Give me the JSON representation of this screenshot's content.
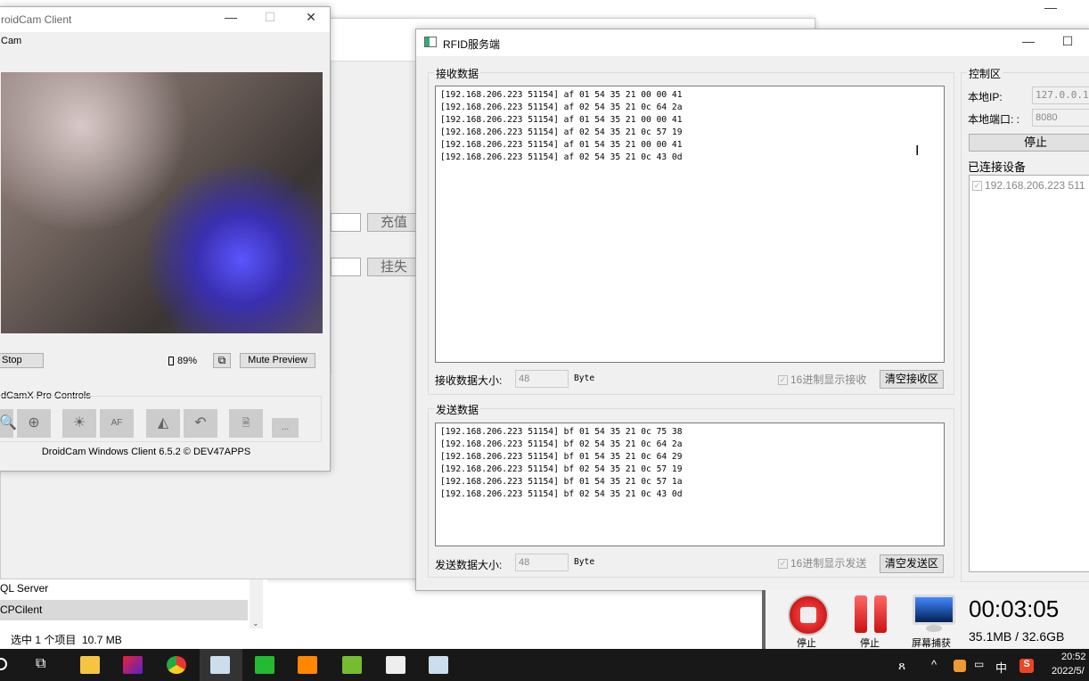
{
  "background_window": {
    "recharge_label": "充值",
    "report_loss_label": "挂失"
  },
  "explorer": {
    "items": [
      "QL Server",
      "CPCilent"
    ],
    "status": "选中 1 个项目  10.7 MB"
  },
  "droidcam": {
    "title": "roidCam Client",
    "menu": "Cam",
    "stop_label": "Stop",
    "battery": "89%",
    "mute_label": "Mute Preview",
    "pro_controls_label": "dCamX Pro Controls",
    "af_label": "AF",
    "more_label": "...",
    "footer": "DroidCam Windows Client 6.5.2 © DEV47APPS"
  },
  "rfid": {
    "title": "RFID服务端",
    "receive": {
      "group_label": "接收数据",
      "lines": [
        "[192.168.206.223 51154] af 01 54 35 21 00 00 41",
        "[192.168.206.223 51154] af 02 54 35 21 0c 64 2a",
        "[192.168.206.223 51154] af 01 54 35 21 00 00 41",
        "[192.168.206.223 51154] af 02 54 35 21 0c 57 19",
        "[192.168.206.223 51154] af 01 54 35 21 00 00 41",
        "[192.168.206.223 51154] af 02 54 35 21 0c 43 0d"
      ],
      "size_label": "接收数据大小:",
      "size_value": "48",
      "unit": "Byte",
      "hex_label": "16进制显示接收",
      "hex_checked": true,
      "clear_label": "清空接收区"
    },
    "send": {
      "group_label": "发送数据",
      "lines": [
        "[192.168.206.223 51154] bf 01 54 35 21 0c 75 38",
        "[192.168.206.223 51154] bf 02 54 35 21 0c 64 2a",
        "[192.168.206.223 51154] bf 01 54 35 21 0c 64 29",
        "[192.168.206.223 51154] bf 02 54 35 21 0c 57 19",
        "[192.168.206.223 51154] bf 01 54 35 21 0c 57 1a",
        "[192.168.206.223 51154] bf 02 54 35 21 0c 43 0d"
      ],
      "size_label": "发送数据大小:",
      "size_value": "48",
      "unit": "Byte",
      "hex_label": "16进制显示发送",
      "hex_checked": true,
      "clear_label": "清空发送区"
    },
    "control": {
      "group_label": "控制区",
      "ip_label": "本地IP:",
      "ip_value": "127.0.0.1",
      "port_label": "本地端口: :",
      "port_value": "8080",
      "stop_label": "停止",
      "devices_label": "已连接设备",
      "devices": [
        "192.168.206.223 511"
      ]
    }
  },
  "recorder": {
    "stop_label": "停止",
    "pause_label": "停止",
    "capture_label": "屏幕捕获",
    "time": "00:03:05",
    "size": "35.1MB / 32.6GB"
  },
  "taskbar": {
    "ime": "中",
    "time": "20:52",
    "date": "2022/5/"
  }
}
